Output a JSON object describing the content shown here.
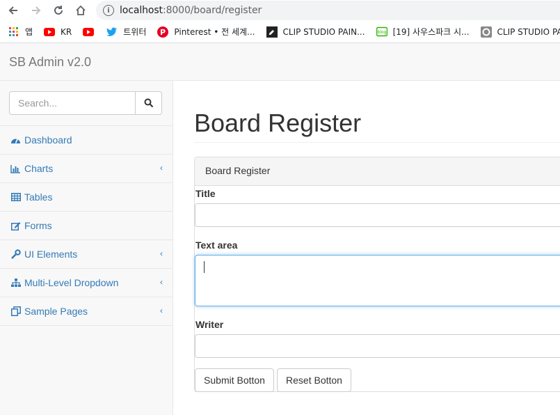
{
  "browser": {
    "url_host": "localhost",
    "url_rest": ":8000/board/register",
    "bookmarks": [
      {
        "label": "앱",
        "icon": "apps-grid-icon"
      },
      {
        "label": "KR",
        "icon": "youtube-icon"
      },
      {
        "label": "",
        "icon": "youtube-icon"
      },
      {
        "label": "트위터",
        "icon": "twitter-icon"
      },
      {
        "label": "Pinterest • 전 세계...",
        "icon": "pinterest-icon"
      },
      {
        "label": "CLIP STUDIO PAIN...",
        "icon": "clip-studio-icon"
      },
      {
        "label": "[19] 사우스파크 시...",
        "icon": "blog-icon"
      },
      {
        "label": "CLIP STUDIO PAI",
        "icon": "clip-studio-gray-icon"
      }
    ]
  },
  "navbar": {
    "brand": "SB Admin v2.0"
  },
  "sidebar": {
    "search_placeholder": "Search...",
    "items": [
      {
        "label": "Dashboard",
        "icon": "dashboard-icon",
        "has_arrow": false
      },
      {
        "label": "Charts",
        "icon": "bar-chart-icon",
        "has_arrow": true
      },
      {
        "label": "Tables",
        "icon": "table-icon",
        "has_arrow": false
      },
      {
        "label": "Forms",
        "icon": "edit-icon",
        "has_arrow": false
      },
      {
        "label": "UI Elements",
        "icon": "wrench-icon",
        "has_arrow": true
      },
      {
        "label": "Multi-Level Dropdown",
        "icon": "sitemap-icon",
        "has_arrow": true
      },
      {
        "label": "Sample Pages",
        "icon": "files-icon",
        "has_arrow": true
      }
    ],
    "arrow_glyph": "‹"
  },
  "page": {
    "title": "Board Register",
    "panel_heading": "Board Register",
    "form": {
      "title_label": "Title",
      "textarea_label": "Text area",
      "writer_label": "Writer",
      "submit_label": "Submit Botton",
      "reset_label": "Reset Botton"
    }
  },
  "colors": {
    "link": "#337ab7",
    "navbar_bg": "#f8f8f8",
    "focus_border": "#66afe9"
  }
}
